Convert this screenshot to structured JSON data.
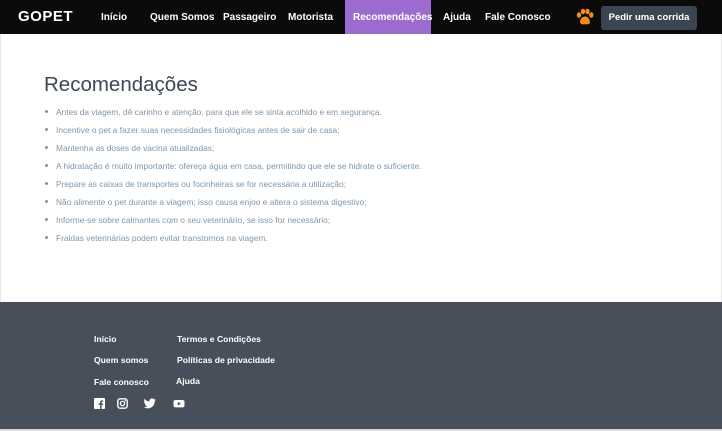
{
  "navbar": {
    "brand": "GOPET",
    "items": [
      {
        "label": "Início"
      },
      {
        "label": "Quem Somos"
      },
      {
        "label": "Passageiro"
      },
      {
        "label": "Motorista"
      },
      {
        "label": "Recomendações",
        "active": true
      },
      {
        "label": "Ajuda"
      },
      {
        "label": "Fale Conosco"
      }
    ],
    "cta_label": "Pedir uma corrida",
    "paw_icon": "paw-icon"
  },
  "main": {
    "title": "Recomendações",
    "recommendations": [
      "Antes da viagem, dê carinho e atenção, para que ele se sinta acolhido e em segurança.",
      "Incentive o pet a fazer suas necessidades fisiológicas antes de sair de casa;",
      "Mantenha as doses de vacina atualizadas;",
      "A hidratação é muito importante: ofereça água em casa, permitindo que ele se hidrate o suficiente.",
      "Prepare as caixas de transportes ou focinheiras se for necessária a utilização;",
      "Não alimente o pet durante a viagem; isso causa enjoo e altera o sistema digestivo;",
      "Informe-se sobre calmantes com o seu veterinário, se isso for necessário;",
      "Fraldas veterinárias podem evitar transtornos na viagem."
    ]
  },
  "footer": {
    "links": [
      {
        "label": "Início"
      },
      {
        "label": "Termos e Condições"
      },
      {
        "label": "Quem somos"
      },
      {
        "label": "Políticas de privacidade"
      },
      {
        "label": "Fale conosco"
      },
      {
        "label": "Ajuda"
      }
    ],
    "social": [
      "facebook-icon",
      "instagram-icon",
      "twitter-icon",
      "youtube-icon"
    ]
  },
  "colors": {
    "navbar_bg": "#0b0b0b",
    "active_nav": "#9b6bcf",
    "cta_bg": "#3c4653",
    "paw": "#f08c1e",
    "list_text": "#7f96aa",
    "title_text": "#3f4754",
    "footer_bg": "#474f5b"
  }
}
